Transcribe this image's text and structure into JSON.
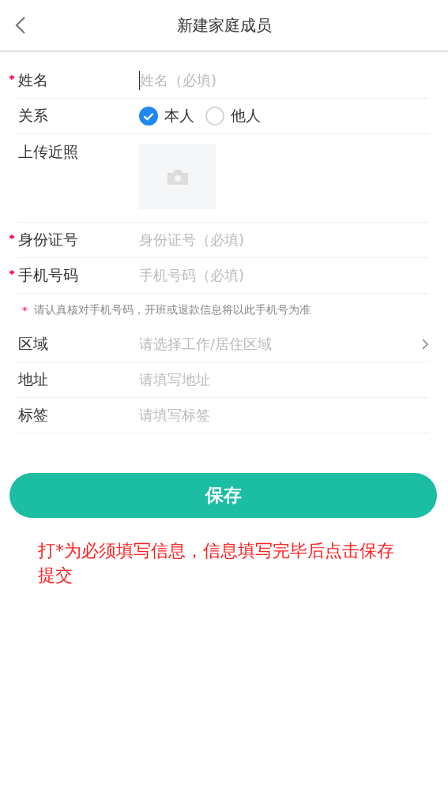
{
  "header": {
    "title": "新建家庭成员"
  },
  "rows": [
    {
      "kind": "text",
      "label": "姓名",
      "required": true,
      "placeholder": "姓名（必填)",
      "focused": true
    },
    {
      "kind": "radio",
      "label": "关系",
      "required": false,
      "options": [
        {
          "label": "本人",
          "selected": true
        },
        {
          "label": "他人",
          "selected": false
        }
      ]
    },
    {
      "kind": "upload",
      "label": "上传近照",
      "required": false
    },
    {
      "kind": "text",
      "label": "身份证号",
      "required": true,
      "placeholder": "身份证号（必填)",
      "focused": false
    },
    {
      "kind": "text",
      "label": "手机号码",
      "required": true,
      "placeholder": "手机号码（必填)",
      "focused": false
    },
    {
      "kind": "note",
      "mark": "*",
      "text": "请认真核对手机号码，开班或退款信息将以此手机号为准"
    },
    {
      "kind": "select",
      "label": "区域",
      "required": false,
      "placeholder": "请选择工作/居住区域"
    },
    {
      "kind": "text",
      "label": "地址",
      "required": false,
      "placeholder": "请填写地址",
      "focused": false
    },
    {
      "kind": "text",
      "label": "标签",
      "required": false,
      "placeholder": "请填写标签",
      "focused": false
    }
  ],
  "save_button": "保存",
  "footer_note": "打*为必须填写信息，信息填写完毕后点击保存提交"
}
